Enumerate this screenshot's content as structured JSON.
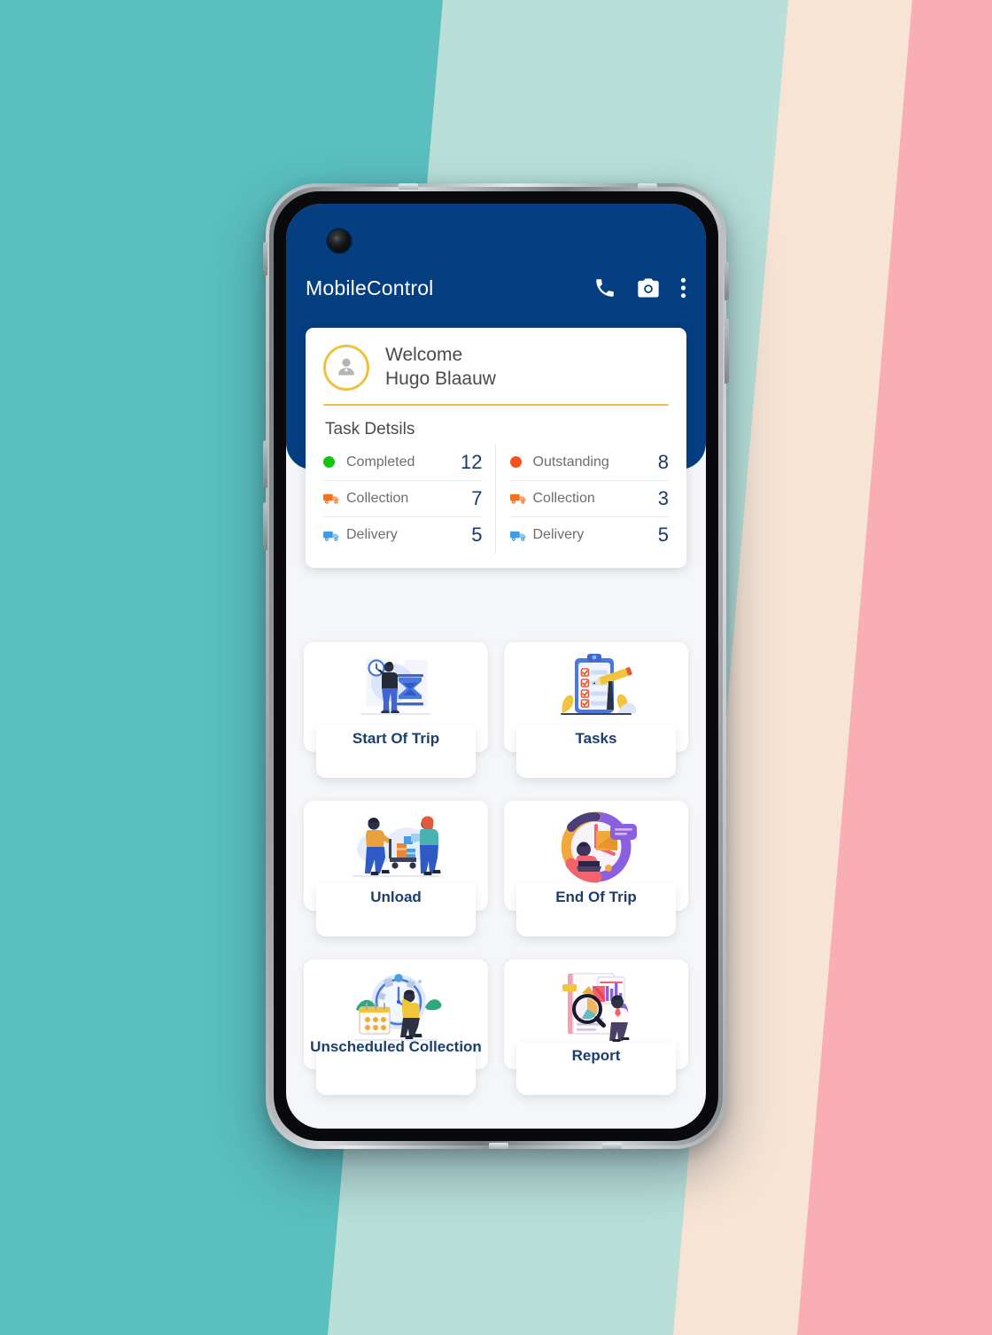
{
  "background": {
    "bands": [
      {
        "name": "teal",
        "color": "#5BBFBF"
      },
      {
        "name": "mint",
        "color": "#B9DFD8"
      },
      {
        "name": "cream",
        "color": "#F7E4D4"
      },
      {
        "name": "pink",
        "color": "#F9AEB3"
      }
    ]
  },
  "device": {
    "frame_color": "#0a0a0c",
    "camera": "punch-hole-camera"
  },
  "app_bar": {
    "title": "MobileControl",
    "navy": "#053E81",
    "actions": [
      {
        "name": "phone-icon",
        "label": "Call"
      },
      {
        "name": "camera-icon",
        "label": "Camera"
      },
      {
        "name": "overflow-menu-icon",
        "label": "More options"
      }
    ]
  },
  "welcome": {
    "greeting": "Welcome",
    "user_name": "Hugo Blaauw",
    "avatar_icon": "user-avatar-icon",
    "accent": "#EFC140"
  },
  "tasks_panel": {
    "title": "Task Detsils",
    "columns": [
      {
        "heading": {
          "label": "Completed",
          "value": "12",
          "icon": "green-status-dot",
          "color": "#12C512"
        },
        "rows": [
          {
            "label": "Collection",
            "value": "7",
            "icon": "collection-truck-icon",
            "color": "#F4701F"
          },
          {
            "label": "Delivery",
            "value": "5",
            "icon": "delivery-truck-icon",
            "color": "#3F9BE8"
          }
        ]
      },
      {
        "heading": {
          "label": "Outstanding",
          "value": "8",
          "icon": "orange-status-dot",
          "color": "#F4511E"
        },
        "rows": [
          {
            "label": "Collection",
            "value": "3",
            "icon": "collection-truck-icon",
            "color": "#F4701F"
          },
          {
            "label": "Delivery",
            "value": "5",
            "icon": "delivery-truck-icon",
            "color": "#3F9BE8"
          }
        ]
      }
    ]
  },
  "menu": {
    "tiles": [
      {
        "label": "Start Of Trip",
        "icon": "start-of-trip-illustration"
      },
      {
        "label": "Tasks",
        "icon": "tasks-clipboard-illustration"
      },
      {
        "label": "Unload",
        "icon": "unload-illustration"
      },
      {
        "label": "End Of Trip",
        "icon": "end-of-trip-illustration"
      },
      {
        "label": "Unscheduled Collection",
        "icon": "unscheduled-collection-illustration"
      },
      {
        "label": "Report",
        "icon": "report-illustration"
      }
    ]
  }
}
